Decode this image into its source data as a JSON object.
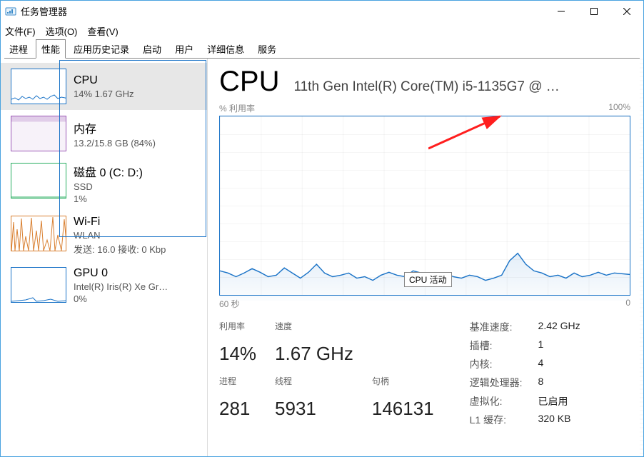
{
  "window": {
    "title": "任务管理器",
    "menu": {
      "file": "文件(F)",
      "options": "选项(O)",
      "view": "查看(V)"
    },
    "tabs": [
      "进程",
      "性能",
      "应用历史记录",
      "启动",
      "用户",
      "详细信息",
      "服务"
    ],
    "active_tab": "性能"
  },
  "sidebar": {
    "items": [
      {
        "title": "CPU",
        "sub": "14%  1.67 GHz"
      },
      {
        "title": "内存",
        "sub": "13.2/15.8 GB (84%)"
      },
      {
        "title": "磁盘 0 (C: D:)",
        "sub1": "SSD",
        "sub2": "1%"
      },
      {
        "title": "Wi-Fi",
        "sub1": "WLAN",
        "sub2": "发送: 16.0 接收: 0 Kbp"
      },
      {
        "title": "GPU 0",
        "sub1": "Intel(R) Iris(R) Xe Gr…",
        "sub2": "0%"
      }
    ]
  },
  "detail": {
    "title": "CPU",
    "subtitle": "11th Gen Intel(R) Core(TM) i5-1135G7 @ …",
    "chart_top_left": "% 利用率",
    "chart_top_right": "100%",
    "chart_bottom_left": "60 秒",
    "chart_bottom_right": "0",
    "tooltip": "CPU 活动",
    "left_stats": {
      "util_label": "利用率",
      "util_val": "14%",
      "speed_label": "速度",
      "speed_val": "1.67 GHz",
      "proc_label": "进程",
      "proc_val": "281",
      "thread_label": "线程",
      "thread_val": "5931",
      "handle_label": "句柄",
      "handle_val": "146131"
    },
    "right_stats": {
      "base_k": "基准速度:",
      "base_v": "2.42 GHz",
      "sockets_k": "插槽:",
      "sockets_v": "1",
      "cores_k": "内核:",
      "cores_v": "4",
      "lp_k": "逻辑处理器:",
      "lp_v": "8",
      "virt_k": "虚拟化:",
      "virt_v": "已启用",
      "l1_k": "L1 缓存:",
      "l1_v": "320 KB"
    }
  },
  "chart_data": {
    "type": "line",
    "title": "% 利用率",
    "ylabel": "% 利用率",
    "ylim": [
      0,
      100
    ],
    "xlabel": "60 秒",
    "xrange_seconds": [
      60,
      0
    ],
    "series": [
      {
        "name": "CPU 活动",
        "values_pct": [
          16,
          14,
          12,
          14,
          17,
          15,
          12,
          13,
          18,
          14,
          11,
          15,
          20,
          14,
          12,
          13,
          14,
          11,
          12,
          10,
          13,
          15,
          13,
          12,
          16,
          14,
          12,
          11,
          14,
          12,
          11,
          13,
          12,
          10,
          11,
          13,
          22,
          26,
          20,
          16,
          14,
          12,
          13,
          11,
          14,
          12,
          13,
          15,
          13,
          14
        ]
      }
    ]
  }
}
